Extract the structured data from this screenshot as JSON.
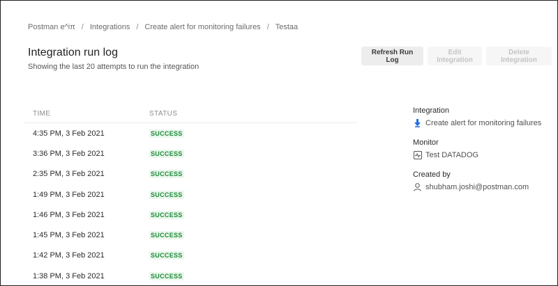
{
  "breadcrumb": {
    "items": [
      "Postman e^iπ",
      "Integrations",
      "Create alert for monitoring failures",
      "Testaa"
    ],
    "separator": "/"
  },
  "header": {
    "title": "Integration run log",
    "subtitle": "Showing the last 20 attempts to run the integration"
  },
  "actions": {
    "refresh_label": "Refresh Run Log",
    "edit_label": "Edit Integration",
    "delete_label": "Delete Integration"
  },
  "table": {
    "columns": [
      "TIME",
      "STATUS"
    ],
    "rows": [
      {
        "time": "4:35 PM, 3 Feb 2021",
        "status": "SUCCESS"
      },
      {
        "time": "3:36 PM, 3 Feb 2021",
        "status": "SUCCESS"
      },
      {
        "time": "2:35 PM, 3 Feb 2021",
        "status": "SUCCESS"
      },
      {
        "time": "1:49 PM, 3 Feb 2021",
        "status": "SUCCESS"
      },
      {
        "time": "1:46 PM, 3 Feb 2021",
        "status": "SUCCESS"
      },
      {
        "time": "1:45 PM, 3 Feb 2021",
        "status": "SUCCESS"
      },
      {
        "time": "1:42 PM, 3 Feb 2021",
        "status": "SUCCESS"
      },
      {
        "time": "1:38 PM, 3 Feb 2021",
        "status": "SUCCESS"
      }
    ]
  },
  "side": {
    "integration_label": "Integration",
    "integration_value": "Create alert for monitoring failures",
    "integration_icon": "integration-icon",
    "monitor_label": "Monitor",
    "monitor_value": "Test DATADOG",
    "monitor_icon": "monitor-icon",
    "created_by_label": "Created by",
    "created_by_value": "shubham.joshi@postman.com",
    "created_by_icon": "user-icon"
  },
  "colors": {
    "success_text": "#1f8a38",
    "success_bg": "#e9f7ec",
    "integration_icon": "#1f6fe0"
  }
}
